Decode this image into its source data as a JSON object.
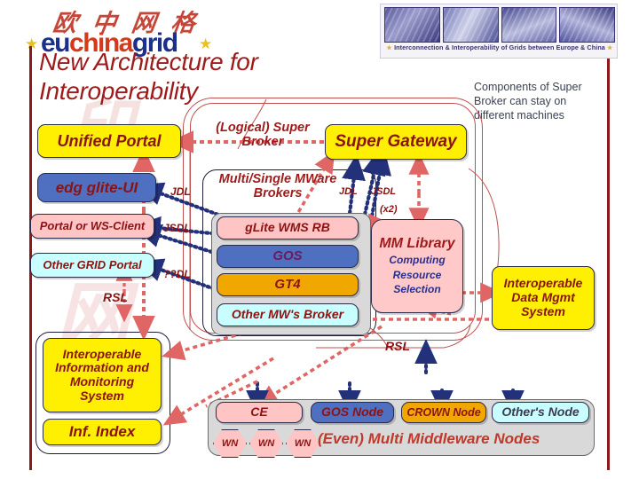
{
  "logo": {
    "cjk": "欧 中 网 格",
    "parts": [
      {
        "t": "eu",
        "c": "#1b2f8c"
      },
      {
        "t": "china",
        "c": "#d43a1a"
      },
      {
        "t": "grid",
        "c": "#1b2f8c"
      }
    ],
    "star_left": "★",
    "star_right": "★"
  },
  "banner": {
    "caption_prefix": "★",
    "caption": "Interconnection & Interoperability of Grids between Europe & China",
    "caption_suffix": "★",
    "images": [
      "lab-photo",
      "dna-map-photo",
      "hand-photo",
      "fiber-photo"
    ]
  },
  "title": "New Architecture for Interoperability",
  "note": "Components of Super Broker can stay on different machines",
  "boxes": {
    "unified_portal": "Unified Portal",
    "edg_glite_ui": "edg glite-UI",
    "portal_ws_client": "Portal or WS-Client",
    "other_grid_portal": "Other GRID Portal",
    "super_gateway": "Super Gateway",
    "glite_wms_rb": "gLite WMS RB",
    "gos": "GOS",
    "gt4": "GT4",
    "other_mw_broker": "Other MW's Broker",
    "mm_library_title": "MM Library",
    "mm_library_l1": "Computing",
    "mm_library_l2": "Resource",
    "mm_library_l3": "Selection",
    "interoperable_data_mgmt": "Interoperable Data Mgmt System",
    "interoperable_info_mon": "Interoperable Information and Monitoring System",
    "inf_index": "Inf. Index",
    "ce": "CE",
    "wn": [
      "WN",
      "WN",
      "WN"
    ],
    "gos_node": "GOS Node",
    "crown_node": "CROWN Node",
    "others_node": "Other's Node",
    "multi_mw_nodes": "(Even) Multi Middleware Nodes"
  },
  "captions": {
    "logical_super_broker": "(Logical) Super Broker",
    "multi_single_mware_brokers": "Multi/Single MWare Brokers"
  },
  "arrow_labels": {
    "jdl_left": "JDL",
    "jsdl_left": "JSDL",
    "unknown_dl": "??DL",
    "rsl_left": "RSL",
    "jdl_right": "JDL",
    "jsdl_right": "JSDL",
    "x2": "(x2)",
    "rsl_right": "RSL"
  },
  "colors": {
    "yellow": "#ffef00",
    "blue": "#4f6fc0",
    "pink": "#ffc4c4",
    "cyan": "#c9feff",
    "amber": "#f0a800",
    "dark_red": "#8b1313",
    "title_red": "#9e1b1b",
    "rule_red": "#8b1a1a",
    "arrow_red": "#e06666",
    "arrow_navy": "#23307a",
    "panel_gray": "#d9d9d9"
  }
}
